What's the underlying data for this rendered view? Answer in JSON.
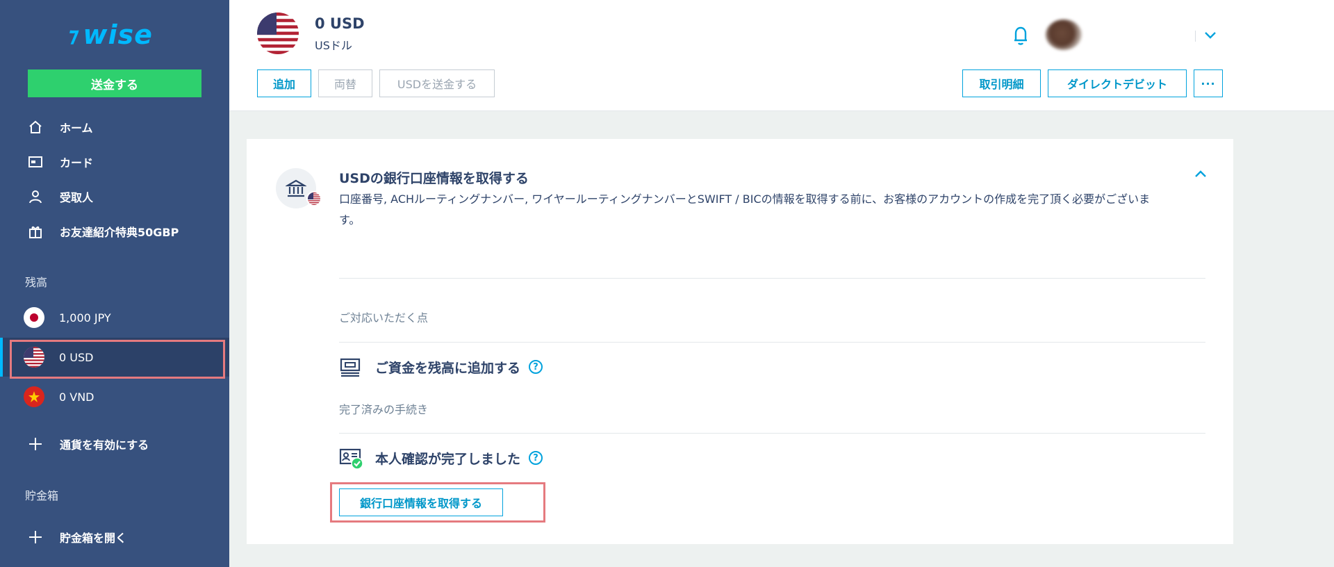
{
  "brand": {
    "name": "wise",
    "accent": "#00b9ff"
  },
  "sidebar": {
    "send_label": "送金する",
    "nav": [
      {
        "label": "ホーム",
        "icon": "home-icon"
      },
      {
        "label": "カード",
        "icon": "card-icon"
      },
      {
        "label": "受取人",
        "icon": "person-icon"
      },
      {
        "label": "お友達紹介特典50GBP",
        "icon": "gift-icon"
      }
    ],
    "balances_label": "残高",
    "balances": [
      {
        "label": "1,000 JPY",
        "flag": "japan-flag-icon"
      },
      {
        "label": "0 USD",
        "flag": "us-flag-icon",
        "active": true
      },
      {
        "label": "0 VND",
        "flag": "vietnam-flag-icon"
      }
    ],
    "add_currency_label": "通貨を有効にする",
    "jars_label": "貯金箱",
    "open_jar_label": "貯金箱を開く"
  },
  "header": {
    "amount": "0 USD",
    "currency_name": "USドル",
    "buttons": {
      "add": "追加",
      "convert": "両替",
      "send_usd": "USDを送金する",
      "statements": "取引明細",
      "direct_debit": "ダイレクトデビット",
      "more": "···"
    }
  },
  "card": {
    "title": "USDの銀行口座情報を取得する",
    "description": "口座番号, ACHルーティングナンバー, ワイヤールーティングナンバーとSWIFT / BICの情報を取得する前に、お客様のアカウントの作成を完了頂く必要がございます。",
    "todo_label": "ご対応いただく点",
    "todo_task": "ご資金を残高に追加する",
    "done_label": "完了済みの手続き",
    "done_task": "本人確認が完了しました",
    "get_button": "銀行口座情報を取得する"
  }
}
